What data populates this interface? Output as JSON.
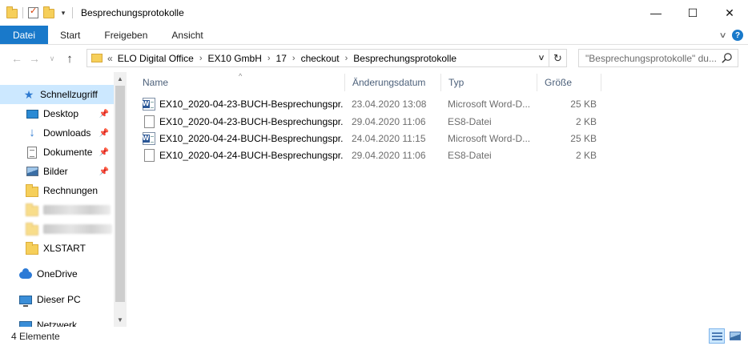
{
  "window": {
    "title": "Besprechungsprotokolle",
    "controls": {
      "minimize": "—",
      "maximize": "☐",
      "close": "✕"
    }
  },
  "quick_access_toolbar": {
    "icons": [
      "folder-icon",
      "properties-icon",
      "new-folder-icon",
      "customize-dropdown-icon"
    ]
  },
  "ribbon": {
    "tabs": [
      {
        "label": "Datei",
        "active": true
      },
      {
        "label": "Start"
      },
      {
        "label": "Freigeben"
      },
      {
        "label": "Ansicht"
      }
    ],
    "accent": "#1979ca"
  },
  "address_bar": {
    "overflow": "«",
    "crumbs": [
      "ELO Digital Office",
      "EX10 GmbH",
      "17",
      "checkout",
      "Besprechungsprotokolle"
    ]
  },
  "search": {
    "placeholder": "\"Besprechungsprotokolle\" du..."
  },
  "nav_pane": {
    "items": [
      {
        "label": "Schnellzugriff",
        "icon": "star-icon",
        "selected": true
      },
      {
        "label": "Desktop",
        "icon": "desktop-icon",
        "pinned": true
      },
      {
        "label": "Downloads",
        "icon": "download-icon",
        "pinned": true
      },
      {
        "label": "Dokumente",
        "icon": "documents-icon",
        "pinned": true
      },
      {
        "label": "Bilder",
        "icon": "pictures-icon",
        "pinned": true
      },
      {
        "label": "Rechnungen",
        "icon": "folder-icon"
      },
      {
        "label": "",
        "icon": "folder-icon",
        "blurred": true
      },
      {
        "label": "",
        "icon": "folder-icon",
        "blurred": true
      },
      {
        "label": "XLSTART",
        "icon": "folder-icon"
      },
      {
        "label": "OneDrive",
        "icon": "onedrive-icon"
      },
      {
        "label": "Dieser PC",
        "icon": "pc-icon"
      },
      {
        "label": "Netzwerk",
        "icon": "network-icon"
      }
    ]
  },
  "file_list": {
    "columns": [
      "Name",
      "Änderungsdatum",
      "Typ",
      "Größe"
    ],
    "rows": [
      {
        "name": "EX10_2020-04-23-BUCH-Besprechungspr...",
        "date": "23.04.2020 13:08",
        "type": "Microsoft Word-D...",
        "size": "25 KB",
        "icon": "word-document-icon"
      },
      {
        "name": "EX10_2020-04-23-BUCH-Besprechungspr...",
        "date": "29.04.2020 11:06",
        "type": "ES8-Datei",
        "size": "2 KB",
        "icon": "file-icon"
      },
      {
        "name": "EX10_2020-04-24-BUCH-Besprechungspr...",
        "date": "24.04.2020 11:15",
        "type": "Microsoft Word-D...",
        "size": "25 KB",
        "icon": "word-document-icon"
      },
      {
        "name": "EX10_2020-04-24-BUCH-Besprechungspr...",
        "date": "29.04.2020 11:06",
        "type": "ES8-Datei",
        "size": "2 KB",
        "icon": "file-icon"
      }
    ]
  },
  "status_bar": {
    "item_count": "4 Elemente"
  }
}
